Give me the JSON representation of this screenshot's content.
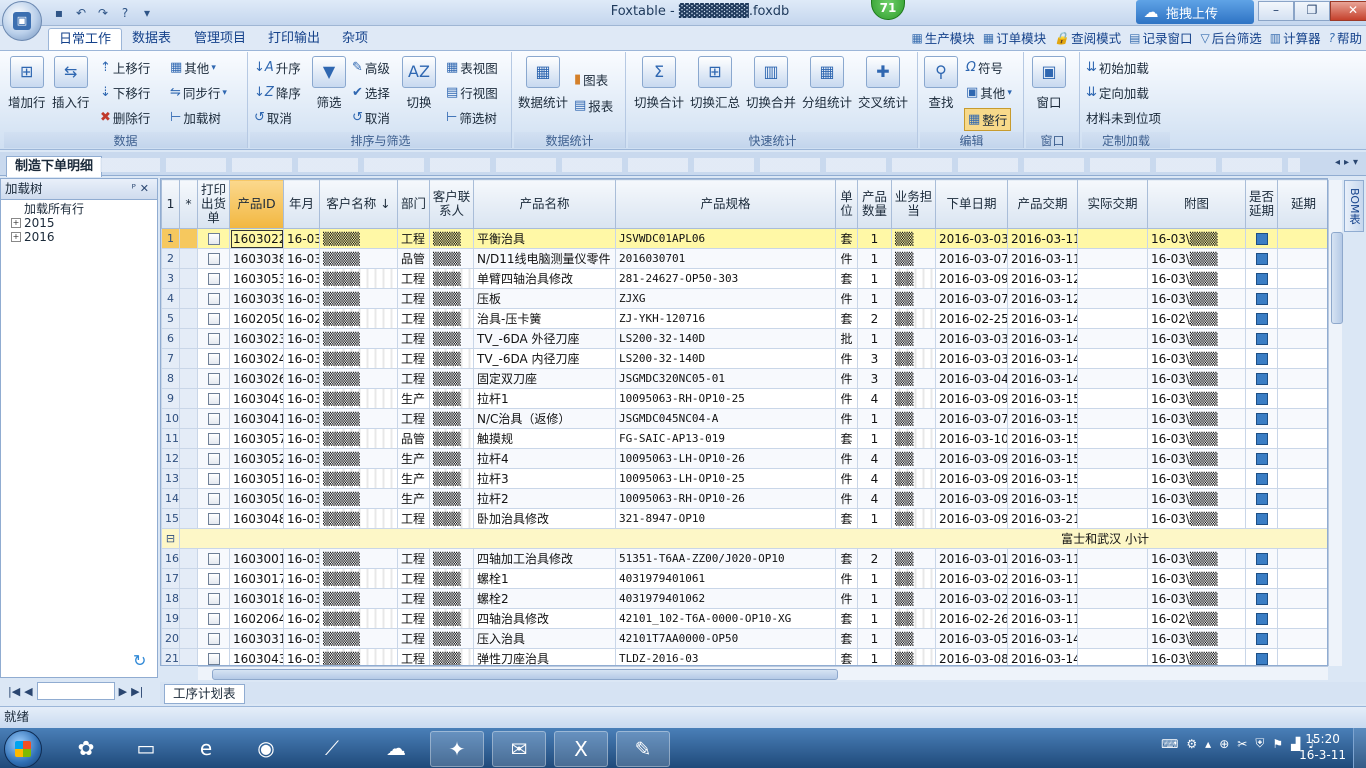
{
  "window": {
    "title": "Foxtable - ▓▓▓▓▓▓▓.foxdb",
    "badge": "71",
    "upload_label": "拖拽上传"
  },
  "ribbon_tabs": [
    "日常工作",
    "数据表",
    "管理项目",
    "打印输出",
    "杂项"
  ],
  "right_links": [
    "生产模块",
    "订单模块",
    "查阅模式",
    "记录窗口",
    "后台筛选",
    "计算器",
    "帮助"
  ],
  "groups": {
    "data": {
      "label": "数据",
      "add_row": "增加行",
      "insert_row": "插入行",
      "move_up": "上移行",
      "move_down": "下移行",
      "delete_row": "删除行",
      "other": "其他",
      "sync": "同步行",
      "load_tree": "加载树"
    },
    "sort_filter": {
      "label": "排序与筛选",
      "asc": "升序",
      "desc": "降序",
      "cancel": "取消",
      "filter": "筛选",
      "advanced": "高级",
      "select": "选择",
      "cancel2": "取消",
      "switch": "切换",
      "table_view": "表视图",
      "row_view": "行视图",
      "filter_tree": "筛选树"
    },
    "stats": {
      "label": "数据统计",
      "data_stats": "数据统计",
      "chart": "图表",
      "report": "报表"
    },
    "quick_stats": {
      "label": "快速统计",
      "switch_total": "切换合计",
      "switch_summary": "切换汇总",
      "switch_merge": "切换合并",
      "group_stats": "分组统计",
      "cross_stats": "交叉统计"
    },
    "edit": {
      "label": "编辑",
      "find": "查找",
      "symbol": "符号",
      "other": "其他",
      "whole_row": "整行"
    },
    "window": {
      "label": "窗口",
      "window": "窗口"
    },
    "custom_load": {
      "label": "定制加载",
      "initial": "初始加载",
      "directed": "定向加载",
      "material": "材料未到位项"
    }
  },
  "doc_tab": "制造下单明细",
  "left_panel": {
    "title": "加载树",
    "tree": [
      "加载所有行",
      "2015",
      "2016"
    ]
  },
  "grid": {
    "columns": [
      "",
      "*",
      "打印出货单",
      "产品ID",
      "年月",
      "客户名称",
      "部门",
      "客户联系人",
      "产品名称",
      "产品规格",
      "单位",
      "产品数量",
      "业务担当",
      "下单日期",
      "产品交期",
      "实际交期",
      "附图",
      "是否延期",
      "延期"
    ],
    "header_number": "1",
    "sort_indicator": "↓",
    "subtotal_label": "富士和武汉 小计",
    "rows": [
      {
        "n": "1",
        "id": "1603022",
        "ym": "16-03",
        "cust": "▒▒▒▒",
        "dept": "工程",
        "contact": "▒▒▒",
        "name": "平衡治具",
        "spec": "JSVWDC01APL06",
        "unit": "套",
        "qty": "1",
        "owner": "▒▒",
        "order": "2016-03-03",
        "due": "2016-03-11",
        "att": "16-03\\▒▒▒"
      },
      {
        "n": "2",
        "id": "1603038",
        "ym": "16-03",
        "cust": "▒▒▒▒",
        "dept": "品管",
        "contact": "▒▒▒",
        "name": "N/D11线电脑测量仪零件",
        "spec": "2016030701",
        "unit": "件",
        "qty": "1",
        "owner": "▒▒",
        "order": "2016-03-07",
        "due": "2016-03-11",
        "att": "16-03\\▒▒▒"
      },
      {
        "n": "3",
        "id": "1603053",
        "ym": "16-03",
        "cust": "▒▒▒▒",
        "dept": "工程",
        "contact": "▒▒▒",
        "name": "单臂四轴治具修改",
        "spec": "281-24627-OP50-303",
        "unit": "套",
        "qty": "1",
        "owner": "▒▒",
        "order": "2016-03-09",
        "due": "2016-03-12",
        "att": "16-03\\▒▒▒"
      },
      {
        "n": "4",
        "id": "1603039",
        "ym": "16-03",
        "cust": "▒▒▒▒",
        "dept": "工程",
        "contact": "▒▒▒",
        "name": "压板",
        "spec": "ZJXG",
        "unit": "件",
        "qty": "1",
        "owner": "▒▒",
        "order": "2016-03-07",
        "due": "2016-03-12",
        "att": "16-03\\▒▒▒"
      },
      {
        "n": "5",
        "id": "1602050",
        "ym": "16-02",
        "cust": "▒▒▒▒",
        "dept": "工程",
        "contact": "▒▒▒",
        "name": "治具-压卡簧",
        "spec": "ZJ-YKH-120716",
        "unit": "套",
        "qty": "2",
        "owner": "▒▒",
        "order": "2016-02-25",
        "due": "2016-03-14",
        "att": "16-02\\▒▒▒"
      },
      {
        "n": "6",
        "id": "1603023",
        "ym": "16-03",
        "cust": "▒▒▒▒",
        "dept": "工程",
        "contact": "▒▒▒",
        "name": "TV_-6DA 外径刀座",
        "spec": "LS200-32-140D",
        "unit": "批",
        "qty": "1",
        "owner": "▒▒",
        "order": "2016-03-03",
        "due": "2016-03-14",
        "att": "16-03\\▒▒▒"
      },
      {
        "n": "7",
        "id": "1603024",
        "ym": "16-03",
        "cust": "▒▒▒▒",
        "dept": "工程",
        "contact": "▒▒▒",
        "name": "TV_-6DA 内径刀座",
        "spec": "LS200-32-140D",
        "unit": "件",
        "qty": "3",
        "owner": "▒▒",
        "order": "2016-03-03",
        "due": "2016-03-14",
        "att": "16-03\\▒▒▒"
      },
      {
        "n": "8",
        "id": "1603026",
        "ym": "16-03",
        "cust": "▒▒▒▒",
        "dept": "工程",
        "contact": "▒▒▒",
        "name": "固定双刀座",
        "spec": "JSGMDC320NC05-01",
        "unit": "件",
        "qty": "3",
        "owner": "▒▒",
        "order": "2016-03-04",
        "due": "2016-03-14",
        "att": "16-03\\▒▒▒"
      },
      {
        "n": "9",
        "id": "1603049",
        "ym": "16-03",
        "cust": "▒▒▒▒",
        "dept": "生产",
        "contact": "▒▒▒",
        "name": "拉杆1",
        "spec": "10095063-RH-OP10-25",
        "unit": "件",
        "qty": "4",
        "owner": "▒▒",
        "order": "2016-03-09",
        "due": "2016-03-15",
        "att": "16-03\\▒▒▒"
      },
      {
        "n": "10",
        "id": "1603041",
        "ym": "16-03",
        "cust": "▒▒▒▒",
        "dept": "工程",
        "contact": "▒▒▒",
        "name": "N/C治具（返修）",
        "spec": "JSGMDC045NC04-A",
        "unit": "件",
        "qty": "1",
        "owner": "▒▒",
        "order": "2016-03-07",
        "due": "2016-03-15",
        "att": "16-03\\▒▒▒"
      },
      {
        "n": "11",
        "id": "1603057",
        "ym": "16-03",
        "cust": "▒▒▒▒",
        "dept": "品管",
        "contact": "▒▒▒",
        "name": "触摸规",
        "spec": "FG-SAIC-AP13-019",
        "unit": "套",
        "qty": "1",
        "owner": "▒▒",
        "order": "2016-03-10",
        "due": "2016-03-15",
        "att": "16-03\\▒▒▒"
      },
      {
        "n": "12",
        "id": "1603052",
        "ym": "16-03",
        "cust": "▒▒▒▒",
        "dept": "生产",
        "contact": "▒▒▒",
        "name": "拉杆4",
        "spec": "10095063-LH-OP10-26",
        "unit": "件",
        "qty": "4",
        "owner": "▒▒",
        "order": "2016-03-09",
        "due": "2016-03-15",
        "att": "16-03\\▒▒▒"
      },
      {
        "n": "13",
        "id": "1603051",
        "ym": "16-03",
        "cust": "▒▒▒▒",
        "dept": "生产",
        "contact": "▒▒▒",
        "name": "拉杆3",
        "spec": "10095063-LH-OP10-25",
        "unit": "件",
        "qty": "4",
        "owner": "▒▒",
        "order": "2016-03-09",
        "due": "2016-03-15",
        "att": "16-03\\▒▒▒"
      },
      {
        "n": "14",
        "id": "1603050",
        "ym": "16-03",
        "cust": "▒▒▒▒",
        "dept": "生产",
        "contact": "▒▒▒",
        "name": "拉杆2",
        "spec": "10095063-RH-OP10-26",
        "unit": "件",
        "qty": "4",
        "owner": "▒▒",
        "order": "2016-03-09",
        "due": "2016-03-15",
        "att": "16-03\\▒▒▒"
      },
      {
        "n": "15",
        "id": "1603048",
        "ym": "16-03",
        "cust": "▒▒▒▒",
        "dept": "工程",
        "contact": "▒▒▒",
        "name": "卧加治具修改",
        "spec": "321-8947-OP10",
        "unit": "套",
        "qty": "1",
        "owner": "▒▒",
        "order": "2016-03-09",
        "due": "2016-03-21",
        "att": "16-03\\▒▒▒"
      },
      {
        "n": "16",
        "id": "1603001",
        "ym": "16-03",
        "cust": "▒▒▒▒",
        "dept": "工程",
        "contact": "▒▒▒",
        "name": "四轴加工治具修改",
        "spec": "51351-T6AA-ZZ00/J020-OP10",
        "unit": "套",
        "qty": "2",
        "owner": "▒▒",
        "order": "2016-03-01",
        "due": "2016-03-11",
        "att": "16-03\\▒▒▒"
      },
      {
        "n": "17",
        "id": "1603017",
        "ym": "16-03",
        "cust": "▒▒▒▒",
        "dept": "工程",
        "contact": "▒▒▒",
        "name": "螺栓1",
        "spec": "4031979401061",
        "unit": "件",
        "qty": "1",
        "owner": "▒▒",
        "order": "2016-03-02",
        "due": "2016-03-11",
        "att": "16-03\\▒▒▒"
      },
      {
        "n": "18",
        "id": "1603018",
        "ym": "16-03",
        "cust": "▒▒▒▒",
        "dept": "工程",
        "contact": "▒▒▒",
        "name": "螺栓2",
        "spec": "4031979401062",
        "unit": "件",
        "qty": "1",
        "owner": "▒▒",
        "order": "2016-03-02",
        "due": "2016-03-11",
        "att": "16-03\\▒▒▒"
      },
      {
        "n": "19",
        "id": "1602064",
        "ym": "16-02",
        "cust": "▒▒▒▒",
        "dept": "工程",
        "contact": "▒▒▒",
        "name": "四轴治具修改",
        "spec": "42101_102-T6A-0000-OP10-XG",
        "unit": "套",
        "qty": "1",
        "owner": "▒▒",
        "order": "2016-02-26",
        "due": "2016-03-11",
        "att": "16-02\\▒▒▒"
      },
      {
        "n": "20",
        "id": "1603031",
        "ym": "16-03",
        "cust": "▒▒▒▒",
        "dept": "工程",
        "contact": "▒▒▒",
        "name": "压入治具",
        "spec": "42101T7AA0000-OP50",
        "unit": "套",
        "qty": "1",
        "owner": "▒▒",
        "order": "2016-03-05",
        "due": "2016-03-14",
        "att": "16-03\\▒▒▒"
      },
      {
        "n": "21",
        "id": "1603043",
        "ym": "16-03",
        "cust": "▒▒▒▒",
        "dept": "工程",
        "contact": "▒▒▒",
        "name": "弹性刀座治具",
        "spec": "TLDZ-2016-03",
        "unit": "套",
        "qty": "1",
        "owner": "▒▒",
        "order": "2016-03-08",
        "due": "2016-03-14",
        "att": "16-03\\▒▒▒"
      }
    ]
  },
  "bom_tab": "BOM表",
  "sheet_tab": "工序计划表",
  "status_text": "就绪",
  "taskbar": {
    "time": "15:20",
    "date": "16-3-11"
  }
}
